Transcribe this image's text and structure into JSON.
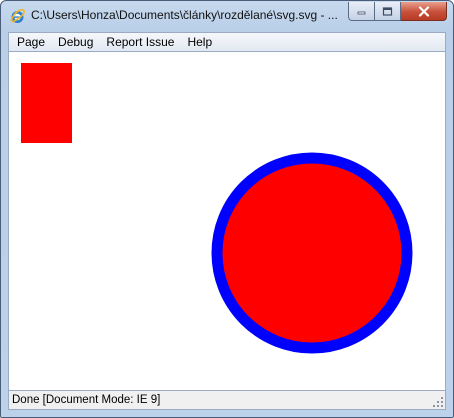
{
  "window": {
    "title": "C:\\Users\\Honza\\Documents\\články\\rozdělané\\svg.svg - ...",
    "icon": "internet-explorer-icon"
  },
  "caption_buttons": {
    "minimize_icon": "minimize-icon",
    "maximize_icon": "maximize-icon",
    "close_icon": "close-icon"
  },
  "menu": {
    "items": [
      "Page",
      "Debug",
      "Report Issue",
      "Help"
    ]
  },
  "svg_document": {
    "rect": {
      "fill": "#ff0000"
    },
    "circle": {
      "fill": "#ff0000",
      "stroke": "#0000ff"
    }
  },
  "status": {
    "text": "Done [Document Mode: IE 9]",
    "grip_icon": "resize-grip-icon"
  }
}
